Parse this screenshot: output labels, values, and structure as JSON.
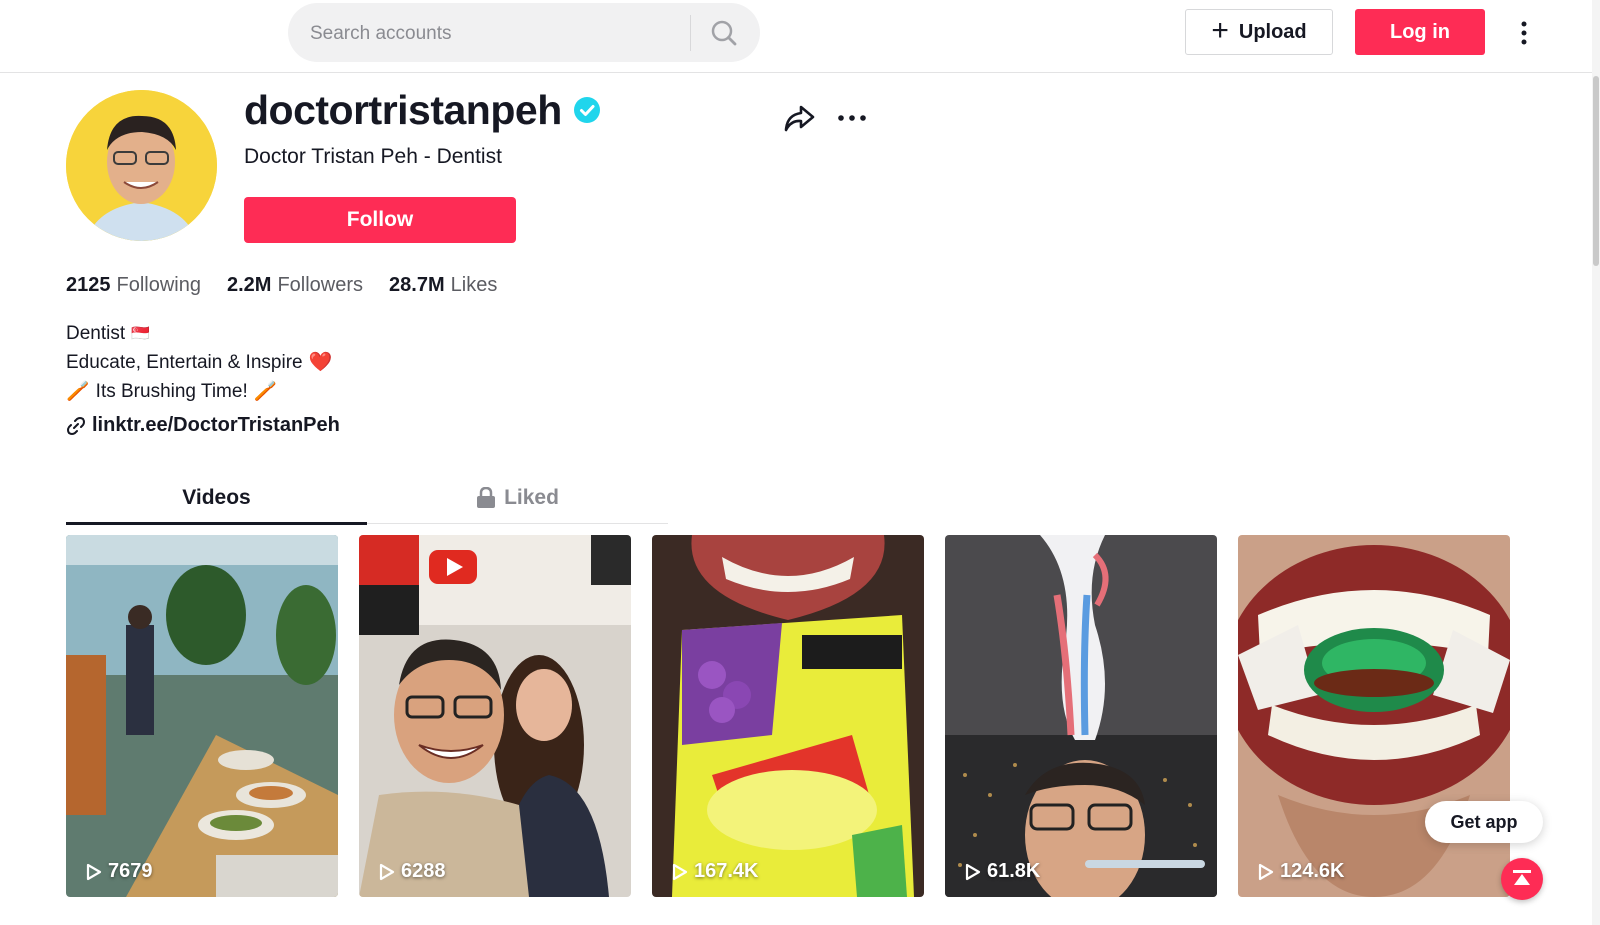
{
  "header": {
    "search_placeholder": "Search accounts",
    "upload_label": "Upload",
    "login_label": "Log in"
  },
  "profile": {
    "username": "doctortristanpeh",
    "full_name": "Doctor Tristan Peh - Dentist",
    "verified": true,
    "follow_label": "Follow",
    "stats": [
      {
        "value": "2125",
        "label": "Following"
      },
      {
        "value": "2.2M",
        "label": "Followers"
      },
      {
        "value": "28.7M",
        "label": "Likes"
      }
    ],
    "bio": [
      {
        "text": "Dentist",
        "emoji": "🇸🇬"
      },
      {
        "text": "Educate, Entertain & Inspire",
        "emoji": "❤️"
      },
      {
        "text": "Its Brushing Time!",
        "emoji": "🪥"
      }
    ],
    "link": "linktr.ee/DoctorTristanPeh"
  },
  "tabs": {
    "videos": "Videos",
    "liked": "Liked"
  },
  "videos": [
    {
      "views": "7679",
      "subject": "buffet spread"
    },
    {
      "views": "6288",
      "subject": "YouTube event selfie"
    },
    {
      "views": "167.4K",
      "subject": "gummy sours pack"
    },
    {
      "views": "61.8K",
      "subject": "toothpaste at night"
    },
    {
      "views": "124.6K",
      "subject": "mint chocs in teeth"
    }
  ],
  "floating": {
    "get_app_label": "Get app"
  },
  "colors": {
    "accent": "#fe2c55",
    "verified": "#20d5ec",
    "text": "#161823",
    "muted": "#8a8b91"
  }
}
